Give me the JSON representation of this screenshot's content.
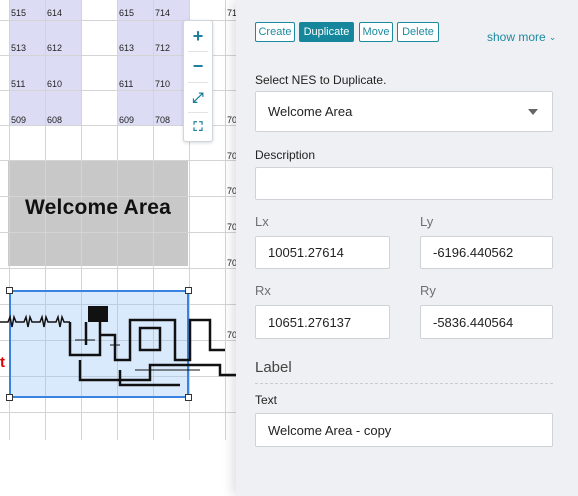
{
  "map": {
    "grid_numbers": [
      {
        "row": 0,
        "cells": [
          "515",
          "614",
          "615",
          "714",
          "71"
        ]
      },
      {
        "row": 1,
        "cells": [
          "513",
          "612",
          "613",
          "712"
        ]
      },
      {
        "row": 2,
        "cells": [
          "511",
          "610",
          "611",
          "710"
        ]
      },
      {
        "row": 3,
        "cells": [
          "509",
          "608",
          "609",
          "708",
          "70"
        ]
      }
    ],
    "edge_numbers": [
      "70",
      "70",
      "70",
      "70",
      "70"
    ],
    "area_label": "Welcome Area",
    "red_marker": "t",
    "zoom": {
      "zoom_in_glyph": "+",
      "zoom_out_glyph": "−",
      "fit_glyph": "⤢",
      "expand_glyph": "⛶"
    }
  },
  "panel": {
    "toolbar": {
      "create": "Create",
      "duplicate": "Duplicate",
      "move": "Move",
      "delete": "Delete",
      "show_more": "show more",
      "active": "duplicate"
    },
    "select_label": "Select NES to Duplicate.",
    "select_value": "Welcome Area",
    "description_label": "Description",
    "description_value": "",
    "lx_label": "Lx",
    "lx_value": "10051.27614",
    "ly_label": "Ly",
    "ly_value": "-6196.440562",
    "rx_label": "Rx",
    "rx_value": "10651.276137",
    "ry_label": "Ry",
    "ry_value": "-5836.440564",
    "label_section": "Label",
    "text_label": "Text",
    "text_value": "Welcome Area - copy"
  },
  "colors": {
    "accent": "#15869c",
    "selection": "#3a82e0",
    "grid_blue": "#dcdcf5",
    "area_gray": "#c8c8c8"
  }
}
